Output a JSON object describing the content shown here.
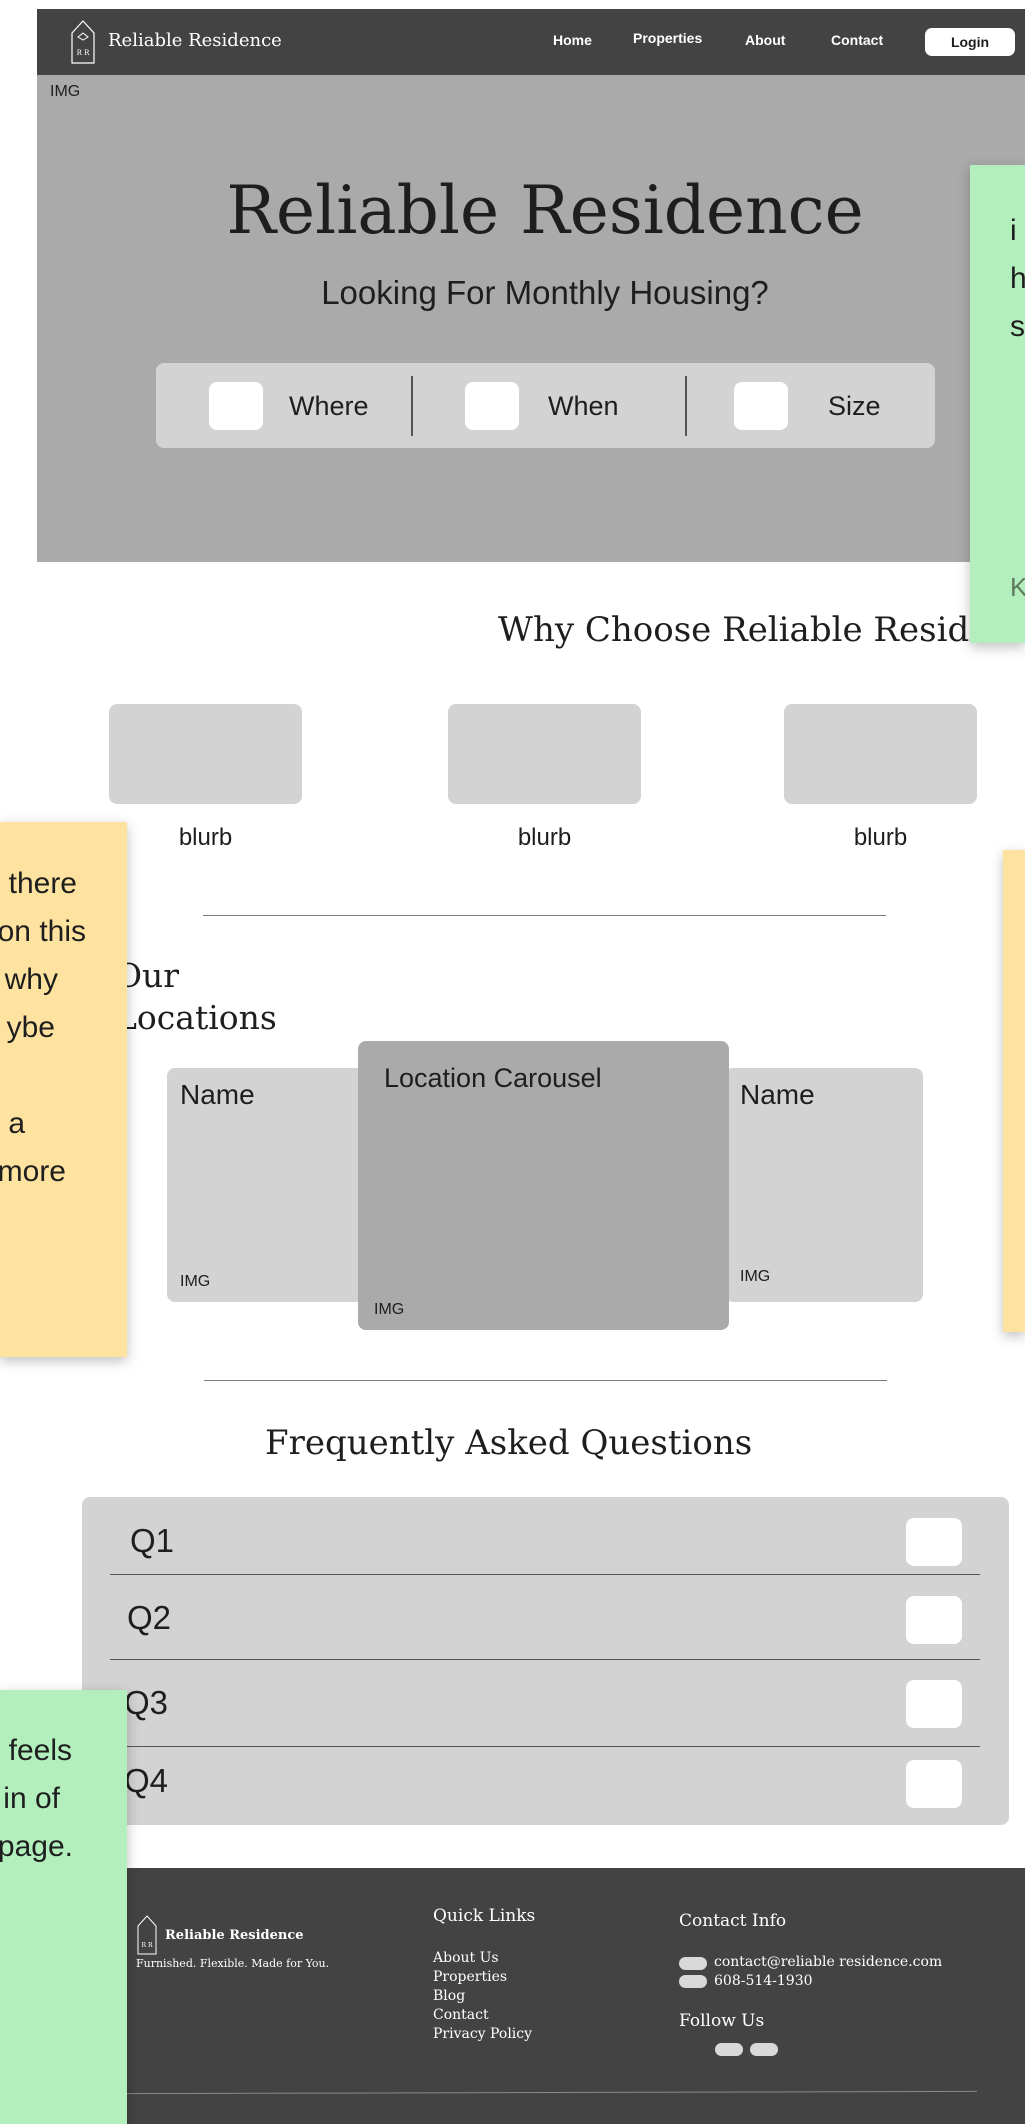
{
  "nav": {
    "brand": "Reliable Residence",
    "links": [
      "Home",
      "Properties",
      "About",
      "Contact"
    ],
    "login": "Login",
    "logo_letters": "R R"
  },
  "hero": {
    "img_label": "IMG",
    "title": "Reliable Residence",
    "subtitle": "Looking For Monthly Housing?",
    "search": [
      "Where",
      "When",
      "Size"
    ]
  },
  "why": {
    "title": "Why Choose Reliable Residence",
    "blurbs": [
      "blurb",
      "blurb",
      "blurb"
    ]
  },
  "locations": {
    "title_line1": "Our",
    "title_line2": "Locations",
    "left": {
      "name": "Name",
      "img": "IMG"
    },
    "center": {
      "name": "Location Carousel",
      "img": "IMG"
    },
    "right": {
      "name": "Name",
      "img": "IMG"
    }
  },
  "faq": {
    "title": "Frequently Asked Questions",
    "questions": [
      "Q1",
      "Q2",
      "Q3",
      "Q4"
    ]
  },
  "footer": {
    "brand": "Reliable Residence",
    "tagline": "Furnished. Flexible. Made for You.",
    "quick_links_title": "Quick Links",
    "quick_links": [
      "About Us",
      "Properties",
      "Blog",
      "Contact",
      "Privacy Policy"
    ],
    "contact_title": "Contact Info",
    "email": "contact@reliable residence.com",
    "phone": "608-514-1930",
    "follow_title": "Follow Us"
  },
  "notes": {
    "green_top": [
      "i",
      "h",
      "s",
      "K"
    ],
    "yellow_left": [
      "there",
      "on this",
      "why",
      "ybe",
      "",
      "a",
      "more"
    ],
    "green_bottom": [
      "feels",
      "in of",
      "page."
    ]
  },
  "colors": {
    "nav_bg": "#434343",
    "hero_bg": "#aaaaaa",
    "panel_bg": "#d3d3d3",
    "sticky_green": "#b3efbd",
    "sticky_yellow": "#fee29f"
  }
}
